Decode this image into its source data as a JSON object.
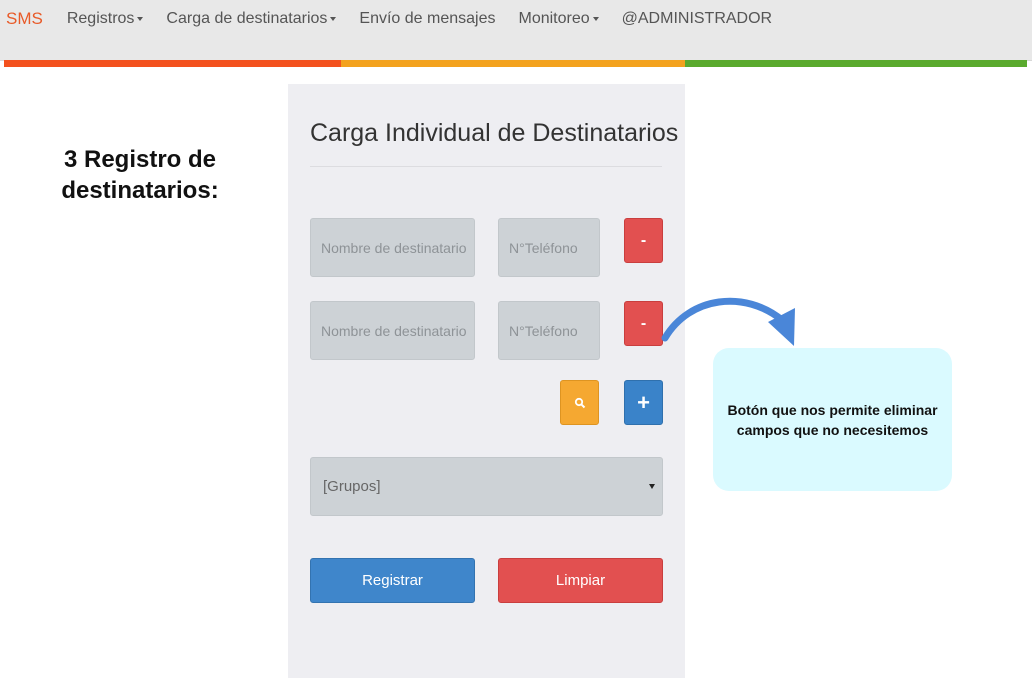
{
  "navbar": {
    "brand": "SMS",
    "items": [
      {
        "label": "Registros",
        "dropdown": true
      },
      {
        "label": "Carga de destinatarios",
        "dropdown": true
      },
      {
        "label": "Envío de mensajes",
        "dropdown": false
      },
      {
        "label": "Monitoreo",
        "dropdown": true
      },
      {
        "label": "@ADMINISTRADOR",
        "dropdown": false
      }
    ],
    "stripe_colors": [
      "#f3511e",
      "#f3a21e",
      "#5aaa2e"
    ]
  },
  "annotation": {
    "step_heading": "3 Registro de destinatarios:",
    "callout_text": "Botón que nos permite eliminar campos que no necesitemos",
    "callout_color": "#dafaff",
    "arrow_color": "#4a86d8"
  },
  "form": {
    "title": "Carga Individual de Destinatarios",
    "rows": [
      {
        "name_placeholder": "Nombre de destinatario",
        "phone_placeholder": "N°Teléfono",
        "remove_label": "-"
      },
      {
        "name_placeholder": "Nombre de destinatario",
        "phone_placeholder": "N°Teléfono",
        "remove_label": "-"
      }
    ],
    "search_icon": "search-icon",
    "add_label": "+",
    "group_select": "[Grupos]",
    "register_label": "Registrar",
    "clear_label": "Limpiar"
  }
}
